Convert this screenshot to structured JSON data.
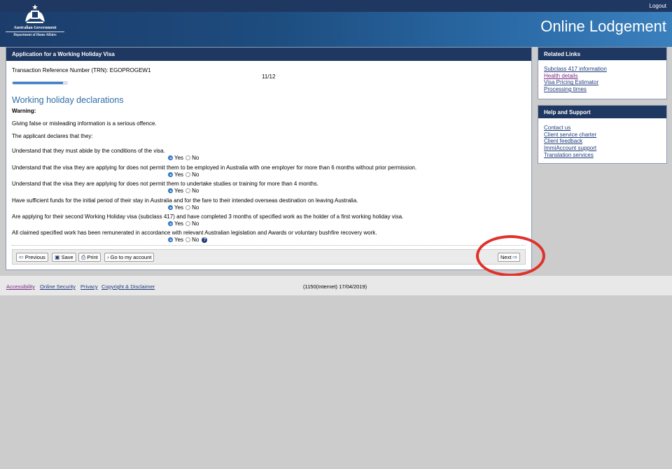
{
  "header": {
    "logout": "Logout",
    "gov_line1": "Australian Government",
    "gov_line2": "Department of Home Affairs",
    "site_title": "Online Lodgement"
  },
  "main": {
    "panel_title": "Application for a Working Holiday Visa",
    "trn": "Transaction Reference Number (TRN): EGOPROGEW1",
    "progress_label": "11/12",
    "progress_fraction": 0.917,
    "section_title": "Working holiday declarations",
    "warning": "Warning:",
    "intro1": "Giving false or misleading information is a serious offence.",
    "intro2": "The applicant declares that they:",
    "yes": "Yes",
    "no": "No",
    "questions": [
      {
        "text": "Understand that they must abide by the conditions of the visa.",
        "answer": "Yes"
      },
      {
        "text": "Understand that the visa they are applying for does not permit them to be employed in Australia with one employer for more than 6 months without prior permission.",
        "answer": "Yes"
      },
      {
        "text": "Understand that the visa they are applying for does not permit them to undertake studies or training for more than 4 months.",
        "answer": "Yes"
      },
      {
        "text": "Have sufficient funds for the initial period of their stay in Australia and for the fare to their intended overseas destination on leaving Australia.",
        "answer": "Yes"
      },
      {
        "text": "Are applying for their second Working Holiday visa (subclass 417) and have completed 3 months of specified work as the holder of a first working holiday visa.",
        "answer": "Yes"
      },
      {
        "text": "All claimed specified work has been remunerated in accordance with relevant Australian legislation and Awards or voluntary bushfire recovery work.",
        "answer": "Yes"
      }
    ],
    "buttons": {
      "previous": "Previous",
      "save": "Save",
      "print": "Print",
      "go_account": "Go to my account",
      "next": "Next"
    }
  },
  "sidebar": {
    "related_title": "Related Links",
    "related_links": [
      "Subclass 417 information",
      "Health details",
      "Visa Pricing Estimator",
      "Processing times"
    ],
    "help_title": "Help and Support",
    "help_links": [
      "Contact us",
      "Client service charter",
      "Client feedback",
      "ImmiAccount support",
      "Translation services"
    ]
  },
  "footer": {
    "links": [
      "Accessibility",
      "Online Security",
      "Privacy",
      "Copyright & Disclaimer"
    ],
    "version": "(1150(Internet) 17/04/2019)"
  },
  "colors": {
    "navy": "#1f3861",
    "link": "#1f3c7a",
    "title_blue": "#2e6da4",
    "annotation_red": "#e0312b"
  }
}
